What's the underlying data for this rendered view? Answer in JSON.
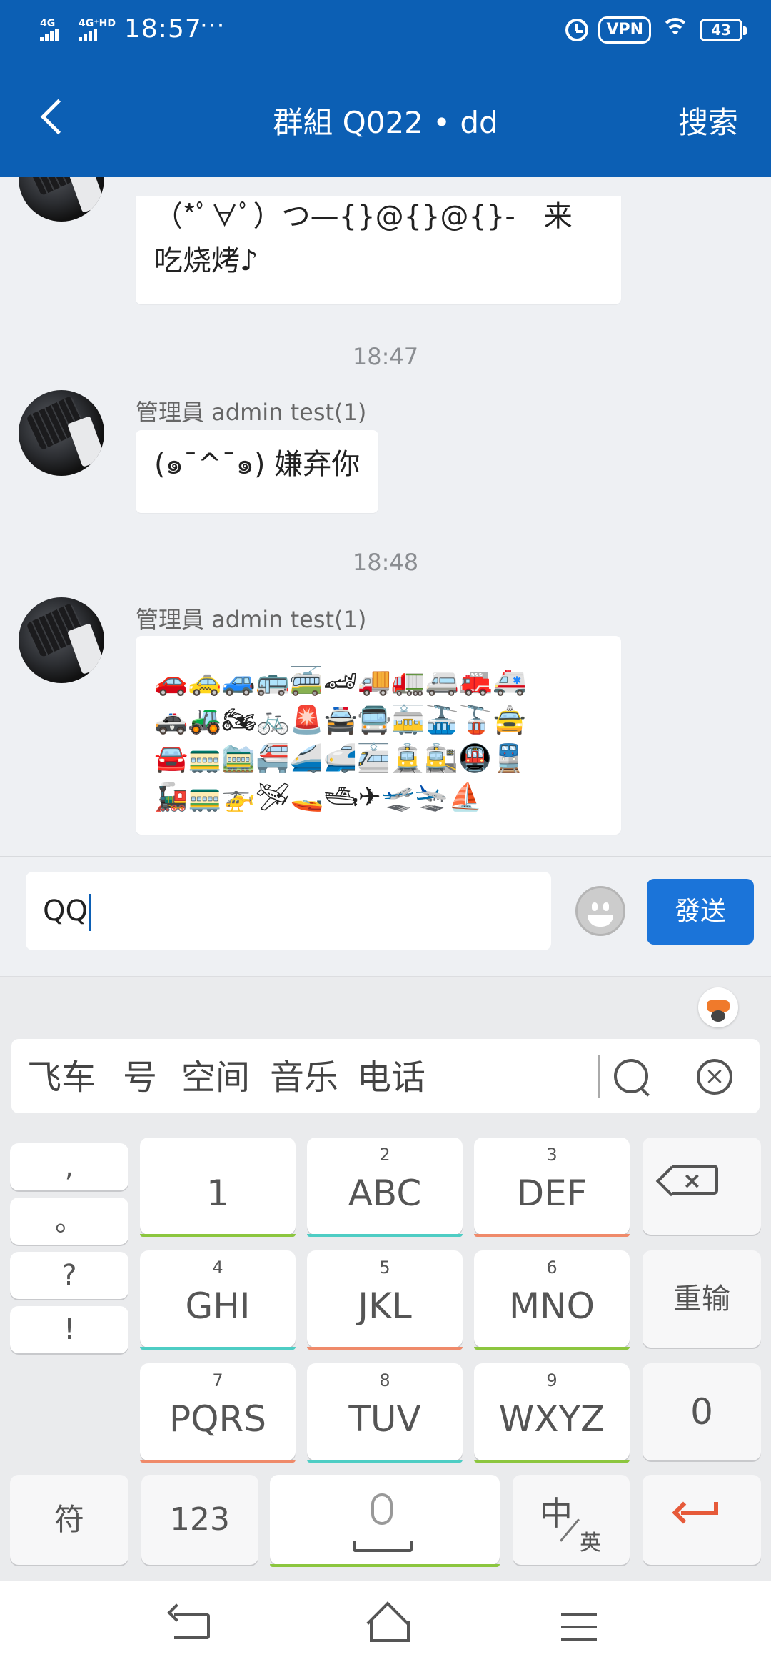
{
  "status_bar": {
    "network1": "4G",
    "network2": "4G⁺HD",
    "time": "18:57",
    "more": "···",
    "vpn": "VPN",
    "battery": "43"
  },
  "header": {
    "title": "群組 Q022 • dd",
    "search_label": "搜索"
  },
  "messages": [
    {
      "text_line1": "（*ﾟ∀ﾟ）つ—{}@{}@{}-　来",
      "text_line2": "吃烧烤♪"
    },
    {
      "timestamp": "18:47",
      "sender": "管理員 admin test(1)",
      "text": "(๑¯^¯๑) 嫌弃你"
    },
    {
      "timestamp": "18:48",
      "sender": "管理員 admin test(1)",
      "emoji_rows": [
        "🚗🚕🚙🚌🚎🏎🚚🚛🚐🚒🚑",
        "🚓🚜🏍🚲🚨🚔🚍🚋🚠🚡🚖",
        "🚘🚃🚞🚝🚄🚅🚈🚊🚉🚇🚆",
        "🚂🚃🚁🛩🚤🛥✈🛫🛬⛵"
      ]
    }
  ],
  "composer": {
    "value": "QQ",
    "send_label": "發送"
  },
  "keyboard": {
    "candidates": [
      "飞车",
      "号",
      "空间",
      "音乐",
      "电话"
    ],
    "punct": [
      ",",
      "。",
      "?",
      "!"
    ],
    "keys": [
      {
        "num": "",
        "label": "1"
      },
      {
        "num": "2",
        "label": "ABC"
      },
      {
        "num": "3",
        "label": "DEF"
      },
      {
        "num": "4",
        "label": "GHI"
      },
      {
        "num": "5",
        "label": "JKL"
      },
      {
        "num": "6",
        "label": "MNO"
      },
      {
        "num": "7",
        "label": "PQRS"
      },
      {
        "num": "8",
        "label": "TUV"
      },
      {
        "num": "9",
        "label": "WXYZ"
      }
    ],
    "retype_label": "重输",
    "zero_label": "0",
    "symbols_label": "符",
    "numbers_label": "123",
    "lang_main": "中",
    "lang_sub": "英"
  },
  "colors": {
    "header_bg": "#0c5fb4",
    "send_button": "#1b74d9",
    "accent_green": "#8cc63f",
    "accent_teal": "#4ecdc4",
    "accent_coral": "#ef8a6a",
    "enter_key": "#e65a3a"
  }
}
